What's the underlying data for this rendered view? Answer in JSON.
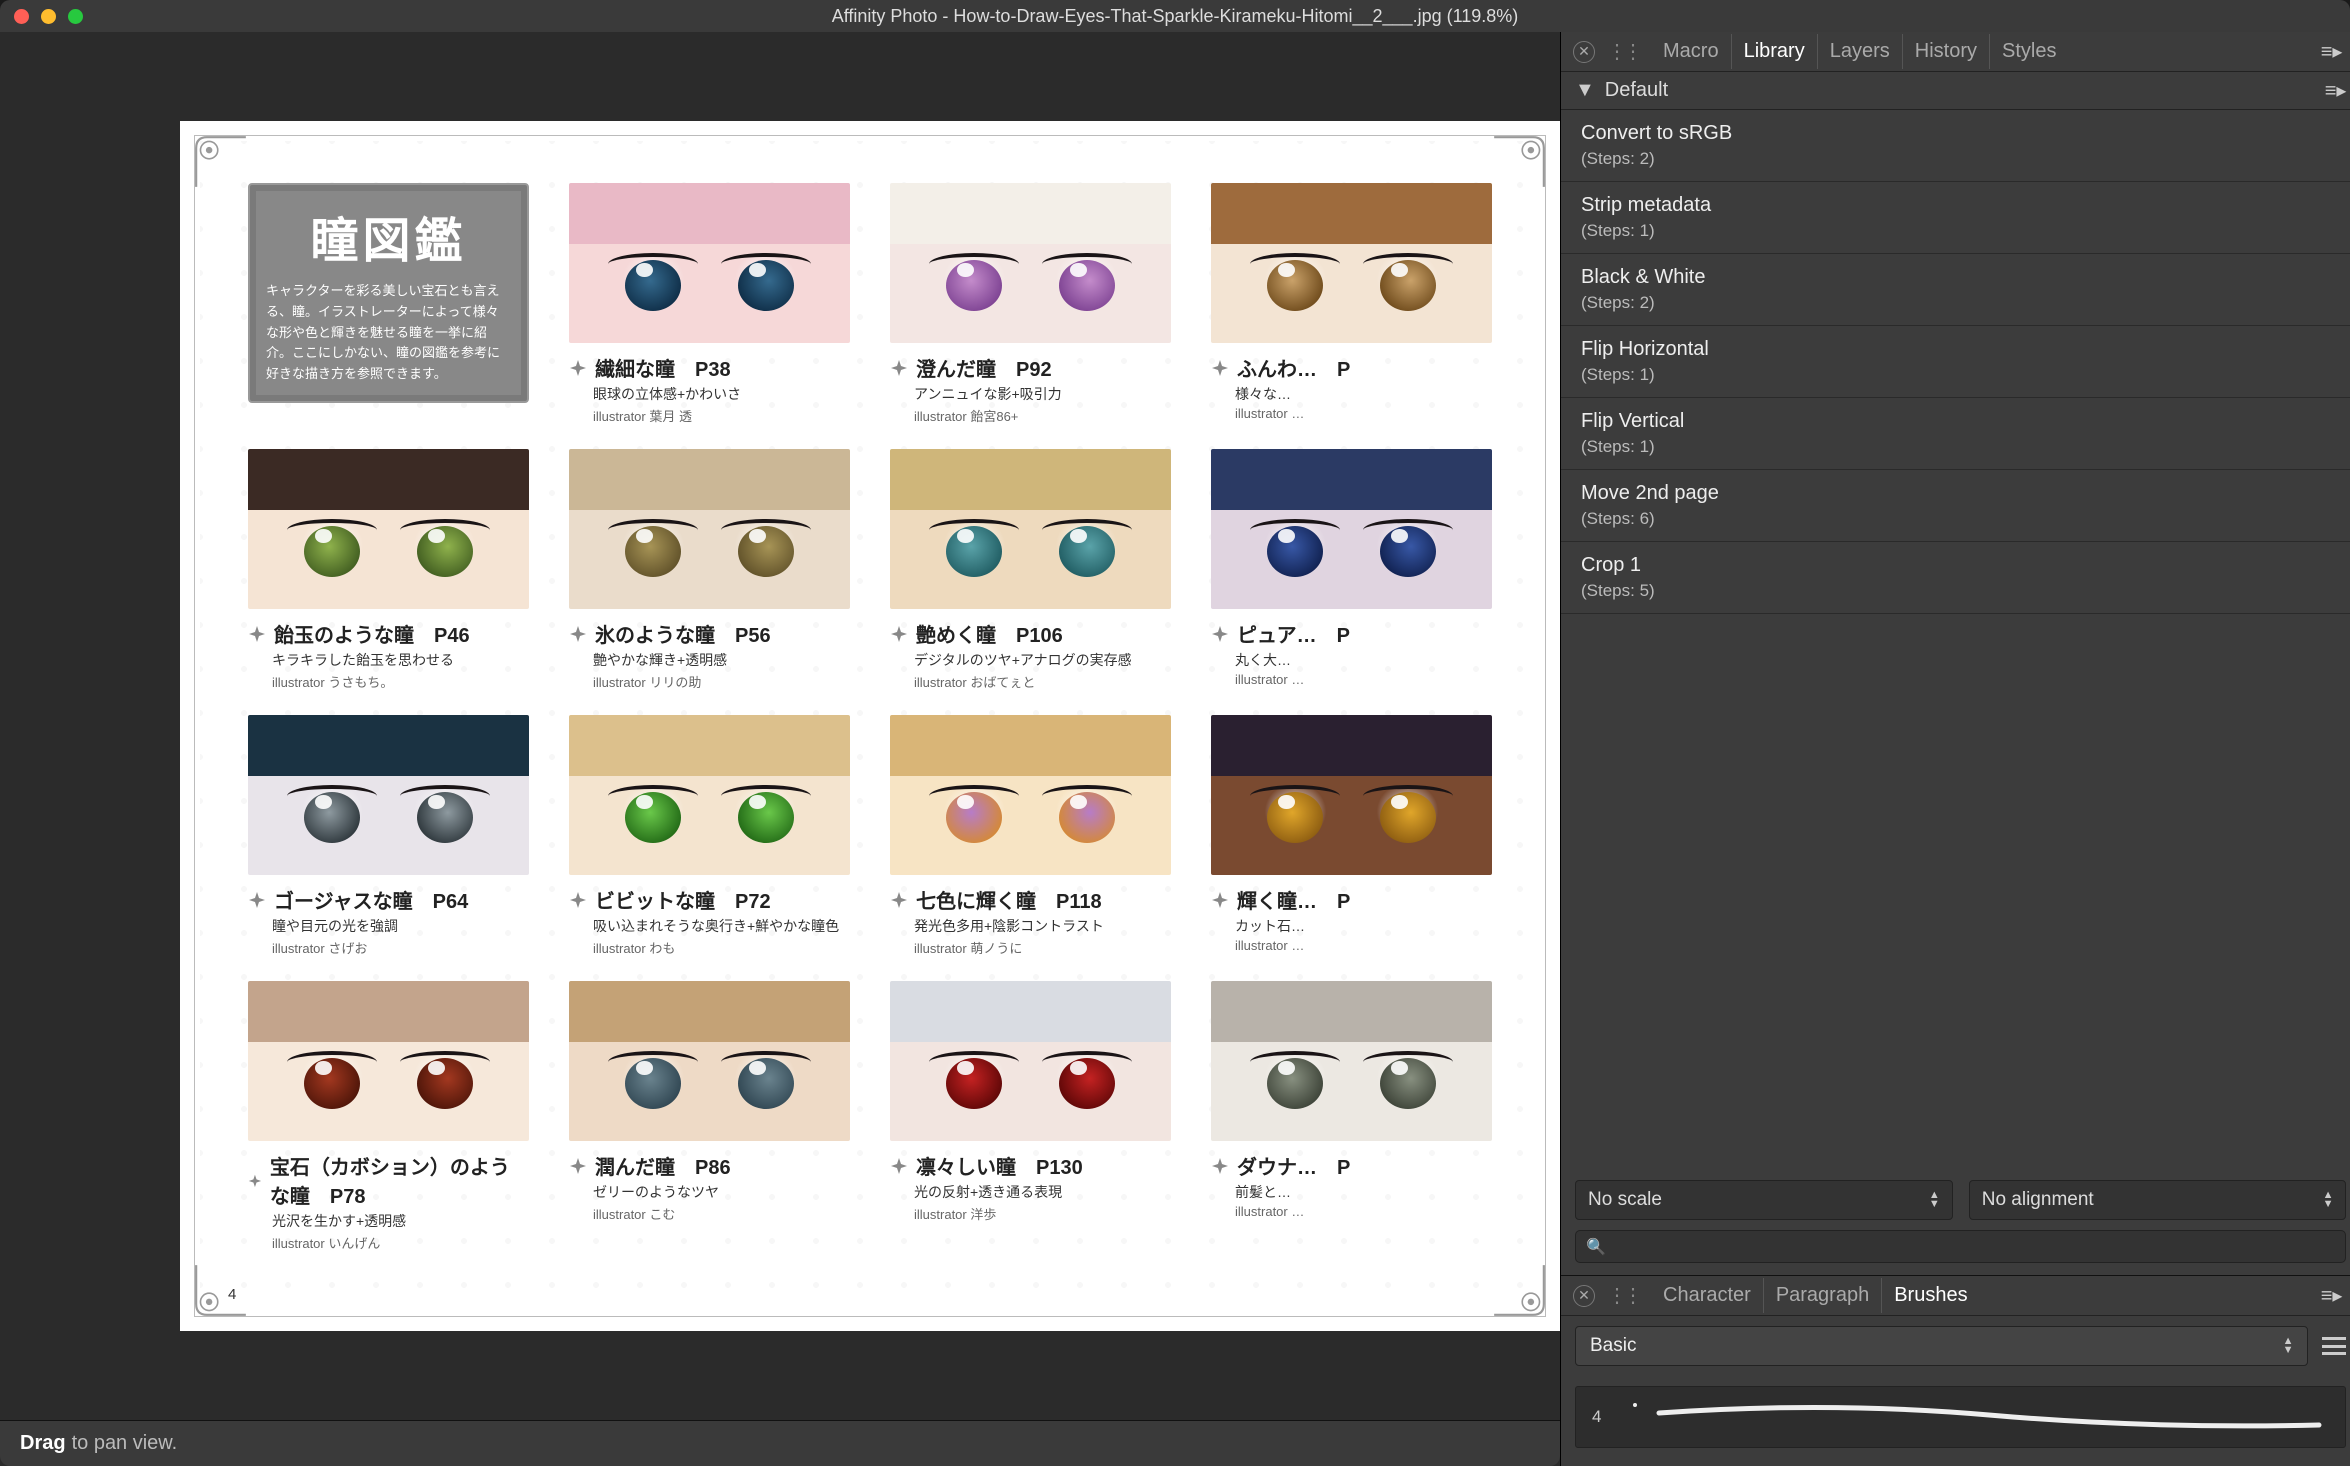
{
  "app": {
    "title": "Affinity Photo - How-to-Draw-Eyes-That-Sparkle-Kirameku-Hitomi__2___.jpg (119.8%)"
  },
  "status": {
    "strong": "Drag",
    "rest": "to pan view."
  },
  "panel": {
    "tabs": [
      {
        "label": "Macro",
        "active": false
      },
      {
        "label": "Library",
        "active": true
      },
      {
        "label": "Layers",
        "active": false
      },
      {
        "label": "History",
        "active": false
      },
      {
        "label": "Styles",
        "active": false
      }
    ],
    "section": "Default",
    "macros": [
      {
        "title": "Convert to sRGB",
        "steps": "(Steps: 2)"
      },
      {
        "title": "Strip metadata",
        "steps": "(Steps: 1)"
      },
      {
        "title": "Black & White",
        "steps": "(Steps: 2)"
      },
      {
        "title": "Flip Horizontal",
        "steps": "(Steps: 1)"
      },
      {
        "title": "Flip Vertical",
        "steps": "(Steps: 1)"
      },
      {
        "title": "Move 2nd page",
        "steps": "(Steps: 6)"
      },
      {
        "title": "Crop 1",
        "steps": "(Steps: 5)"
      }
    ],
    "scale": "No scale",
    "align": "No alignment",
    "search_placeholder": ""
  },
  "brush": {
    "tabs": [
      {
        "label": "Character",
        "active": false
      },
      {
        "label": "Paragraph",
        "active": false
      },
      {
        "label": "Brushes",
        "active": true
      }
    ],
    "category": "Basic",
    "size": "4"
  },
  "doc": {
    "page_num": "4",
    "intro_title": "瞳図鑑",
    "intro_body": "キャラクターを彩る美しい宝石とも言える、瞳。イラストレーターによって様々な形や色と輝きを魅せる瞳を一挙に紹介。ここにしかない、瞳の図鑑を参考に好きな描き方を参照できます。",
    "items": [
      {
        "title": "繊細な瞳　P38",
        "sub": "眼球の立体感+かわいさ",
        "credit": "illustrator 葉月 透",
        "skin": "#f6d8d8",
        "hair": "#e9b9c6",
        "iris": "#356a8e",
        "pupil": "#0d2b44"
      },
      {
        "title": "澄んだ瞳　P92",
        "sub": "アンニュイな影+吸引力",
        "credit": "illustrator 飴宮86+",
        "skin": "#f3e6e3",
        "hair": "#f3efe8",
        "iris": "#c48ccb",
        "pupil": "#7a3f90"
      },
      {
        "title": "ふんわ…　P",
        "sub": "様々な…",
        "credit": "illustrator …",
        "skin": "#f3e4d3",
        "hair": "#9e6b3d",
        "iris": "#caa26a",
        "pupil": "#6b4718"
      },
      {
        "title": "飴玉のような瞳　P46",
        "sub": "キラキラした飴玉を思わせる",
        "credit": "illustrator うさもち。",
        "skin": "#f5e4d4",
        "hair": "#3b2a24",
        "iris": "#8fb24c",
        "pupil": "#3e5a1f"
      },
      {
        "title": "氷のような瞳　P56",
        "sub": "艶やかな輝き+透明感",
        "credit": "illustrator リリの助",
        "skin": "#eadccb",
        "hair": "#cbb796",
        "iris": "#a79456",
        "pupil": "#5e4f28"
      },
      {
        "title": "艶めく瞳　P106",
        "sub": "デジタルのツヤ+アナログの実存感",
        "credit": "illustrator おばてぇと",
        "skin": "#eedabe",
        "hair": "#cfb67a",
        "iris": "#5aa3a9",
        "pupil": "#1e5a60"
      },
      {
        "title": "ピュア…　P",
        "sub": "丸く大…",
        "credit": "illustrator …",
        "skin": "#e0d4e0",
        "hair": "#2b3a64",
        "iris": "#3858a6",
        "pupil": "#0f1f4d"
      },
      {
        "title": "ゴージャスな瞳　P64",
        "sub": "瞳や目元の光を強調",
        "credit": "illustrator さげお",
        "skin": "#e8e4ea",
        "hair": "#1a3242",
        "iris": "#8e9aa0",
        "pupil": "#2a3338"
      },
      {
        "title": "ビビットな瞳　P72",
        "sub": "吸い込まれそうな奥行き+鮮やかな瞳色",
        "credit": "illustrator わも",
        "skin": "#f4e4cf",
        "hair": "#dcc08c",
        "iris": "#6ac84a",
        "pupil": "#1f6614"
      },
      {
        "title": "七色に輝く瞳　P118",
        "sub": "発光色多用+陰影コントラスト",
        "credit": "illustrator 萌ノうに",
        "skin": "#f7e4c4",
        "hair": "#d9b577",
        "iris": "#b77cc8",
        "pupil": "#d68a2e"
      },
      {
        "title": "輝く瞳…　P",
        "sub": "カット石…",
        "credit": "illustrator …",
        "skin": "#7a4a30",
        "hair": "#2a2030",
        "iris": "#e0a62a",
        "pupil": "#8a5a10"
      },
      {
        "title": "宝石（カボション）のような瞳　P78",
        "sub": "光沢を生かす+透明感",
        "credit": "illustrator いんげん",
        "skin": "#f6e8da",
        "hair": "#c3a48c",
        "iris": "#a33820",
        "pupil": "#4a1408"
      },
      {
        "title": "潤んだ瞳　P86",
        "sub": "ゼリーのようなツヤ",
        "credit": "illustrator こむ",
        "skin": "#eedac6",
        "hair": "#c4a276",
        "iris": "#6a838e",
        "pupil": "#2e4450"
      },
      {
        "title": "凛々しい瞳　P130",
        "sub": "光の反射+透き通る表現",
        "credit": "illustrator 洋歩",
        "skin": "#f2e5e0",
        "hair": "#d9dce2",
        "iris": "#c42222",
        "pupil": "#5a0606"
      },
      {
        "title": "ダウナ…　P",
        "sub": "前髪と…",
        "credit": "illustrator …",
        "skin": "#ece8e2",
        "hair": "#b8b2aa",
        "iris": "#889080",
        "pupil": "#3a4035"
      }
    ]
  }
}
